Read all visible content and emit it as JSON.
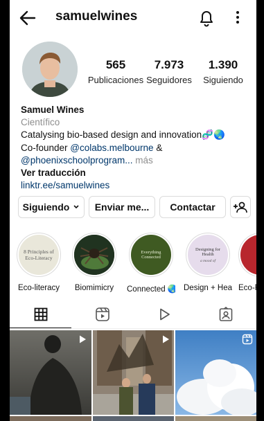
{
  "header": {
    "username": "samuelwines",
    "icons": [
      "back-arrow-icon",
      "bell-icon",
      "more-vertical-icon"
    ]
  },
  "stats": [
    {
      "value": "565",
      "label": "Publicaciones"
    },
    {
      "value": "7.973",
      "label": "Seguidores"
    },
    {
      "value": "1.390",
      "label": "Siguiendo"
    }
  ],
  "bio": {
    "name": "Samuel Wines",
    "category": "Científico",
    "line1": "Catalysing bio-based design and innovation",
    "line1_emoji": "🧬🌏",
    "cofounder": "Co-founder ",
    "mention1": "@colabs.melbourne",
    "amp": " &",
    "mention2": "@phoenixschoolprogram...",
    "more": " más",
    "translate": "Ver traducción",
    "link": "linktr.ee/samuelwines"
  },
  "buttons": {
    "following": "Siguiendo",
    "message": "Enviar me...",
    "contact": "Contactar"
  },
  "highlights": [
    {
      "label": "Eco-literacy",
      "cover_text": "8 Principles of Eco-Literacy"
    },
    {
      "label": "Biomimicry",
      "cover_text": ""
    },
    {
      "label": "Connected 🌏",
      "cover_text": "Everything Connected"
    },
    {
      "label": "Design + Heal...",
      "cover_text": "Designing for Health",
      "cover_subtext": "a mood of"
    },
    {
      "label": "Eco-R",
      "cover_text": ""
    }
  ],
  "tabs": [
    "grid-icon",
    "reels-icon",
    "play-icon",
    "tagged-icon"
  ],
  "colors": {
    "link": "#00376b",
    "secondary": "#8e8e8e",
    "border": "#dbdbdb"
  }
}
